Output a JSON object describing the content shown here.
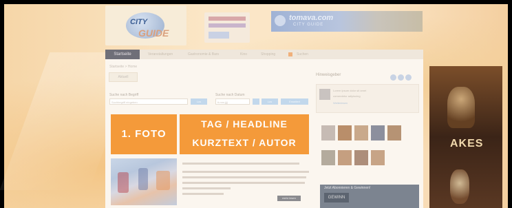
{
  "banner": {
    "logo": {
      "line1": "CITY",
      "line2": "GUIDE"
    },
    "ad_b": {
      "title": "tomava.com",
      "subtitle": "CITY GUIDE"
    }
  },
  "nav": {
    "items": [
      "Startseite",
      "Veranstaltungen",
      "Gastronomie & Bars",
      "Kino",
      "Shopping",
      "Suchen"
    ]
  },
  "content": {
    "breadcrumb": "Startseite > Home",
    "tab": "Aktuell",
    "search_what_label": "Suche nach Begriff",
    "search_where_label": "Suche nach Datum",
    "search_button": "Los",
    "search_button2": "Los",
    "search_button3": "Erweitert",
    "placeholder_1": "Suchbegriff eingeben",
    "placeholder_2": "tt.mm.jjjj",
    "foto_label": "1. FOTO",
    "headline_line1": "TAG / HEADLINE",
    "headline_line2": "KURZTEXT / AUTOR",
    "more_button": "mehr lesen"
  },
  "sidebar": {
    "header": "Hinweisgeber",
    "box_line1": "Lorem ipsum dolor sit amet",
    "box_line2": "consectetur adipiscing",
    "box_link": "Weiterlesen",
    "promo_title": "Jetzt Abonnieren & Gewinnen!",
    "promo_button": "GEWINN"
  },
  "skyscraper": {
    "text": "AKES"
  },
  "colors": {
    "accent_orange": "#f49a3a",
    "nav_active": "#6f6f78"
  }
}
